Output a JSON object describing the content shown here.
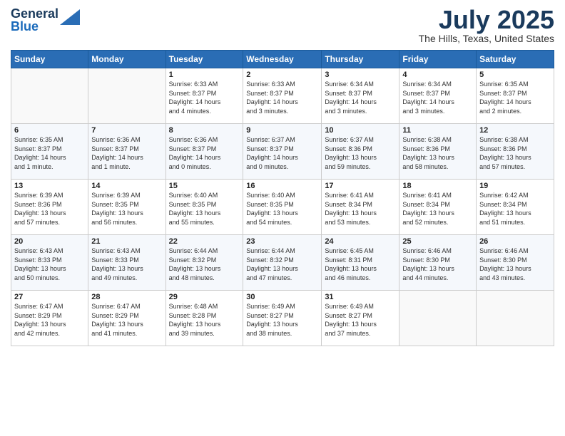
{
  "header": {
    "logo_general": "General",
    "logo_blue": "Blue",
    "month_title": "July 2025",
    "location": "The Hills, Texas, United States"
  },
  "weekdays": [
    "Sunday",
    "Monday",
    "Tuesday",
    "Wednesday",
    "Thursday",
    "Friday",
    "Saturday"
  ],
  "weeks": [
    [
      {
        "day": "",
        "info": ""
      },
      {
        "day": "",
        "info": ""
      },
      {
        "day": "1",
        "info": "Sunrise: 6:33 AM\nSunset: 8:37 PM\nDaylight: 14 hours\nand 4 minutes."
      },
      {
        "day": "2",
        "info": "Sunrise: 6:33 AM\nSunset: 8:37 PM\nDaylight: 14 hours\nand 3 minutes."
      },
      {
        "day": "3",
        "info": "Sunrise: 6:34 AM\nSunset: 8:37 PM\nDaylight: 14 hours\nand 3 minutes."
      },
      {
        "day": "4",
        "info": "Sunrise: 6:34 AM\nSunset: 8:37 PM\nDaylight: 14 hours\nand 3 minutes."
      },
      {
        "day": "5",
        "info": "Sunrise: 6:35 AM\nSunset: 8:37 PM\nDaylight: 14 hours\nand 2 minutes."
      }
    ],
    [
      {
        "day": "6",
        "info": "Sunrise: 6:35 AM\nSunset: 8:37 PM\nDaylight: 14 hours\nand 1 minute."
      },
      {
        "day": "7",
        "info": "Sunrise: 6:36 AM\nSunset: 8:37 PM\nDaylight: 14 hours\nand 1 minute."
      },
      {
        "day": "8",
        "info": "Sunrise: 6:36 AM\nSunset: 8:37 PM\nDaylight: 14 hours\nand 0 minutes."
      },
      {
        "day": "9",
        "info": "Sunrise: 6:37 AM\nSunset: 8:37 PM\nDaylight: 14 hours\nand 0 minutes."
      },
      {
        "day": "10",
        "info": "Sunrise: 6:37 AM\nSunset: 8:36 PM\nDaylight: 13 hours\nand 59 minutes."
      },
      {
        "day": "11",
        "info": "Sunrise: 6:38 AM\nSunset: 8:36 PM\nDaylight: 13 hours\nand 58 minutes."
      },
      {
        "day": "12",
        "info": "Sunrise: 6:38 AM\nSunset: 8:36 PM\nDaylight: 13 hours\nand 57 minutes."
      }
    ],
    [
      {
        "day": "13",
        "info": "Sunrise: 6:39 AM\nSunset: 8:36 PM\nDaylight: 13 hours\nand 57 minutes."
      },
      {
        "day": "14",
        "info": "Sunrise: 6:39 AM\nSunset: 8:35 PM\nDaylight: 13 hours\nand 56 minutes."
      },
      {
        "day": "15",
        "info": "Sunrise: 6:40 AM\nSunset: 8:35 PM\nDaylight: 13 hours\nand 55 minutes."
      },
      {
        "day": "16",
        "info": "Sunrise: 6:40 AM\nSunset: 8:35 PM\nDaylight: 13 hours\nand 54 minutes."
      },
      {
        "day": "17",
        "info": "Sunrise: 6:41 AM\nSunset: 8:34 PM\nDaylight: 13 hours\nand 53 minutes."
      },
      {
        "day": "18",
        "info": "Sunrise: 6:41 AM\nSunset: 8:34 PM\nDaylight: 13 hours\nand 52 minutes."
      },
      {
        "day": "19",
        "info": "Sunrise: 6:42 AM\nSunset: 8:34 PM\nDaylight: 13 hours\nand 51 minutes."
      }
    ],
    [
      {
        "day": "20",
        "info": "Sunrise: 6:43 AM\nSunset: 8:33 PM\nDaylight: 13 hours\nand 50 minutes."
      },
      {
        "day": "21",
        "info": "Sunrise: 6:43 AM\nSunset: 8:33 PM\nDaylight: 13 hours\nand 49 minutes."
      },
      {
        "day": "22",
        "info": "Sunrise: 6:44 AM\nSunset: 8:32 PM\nDaylight: 13 hours\nand 48 minutes."
      },
      {
        "day": "23",
        "info": "Sunrise: 6:44 AM\nSunset: 8:32 PM\nDaylight: 13 hours\nand 47 minutes."
      },
      {
        "day": "24",
        "info": "Sunrise: 6:45 AM\nSunset: 8:31 PM\nDaylight: 13 hours\nand 46 minutes."
      },
      {
        "day": "25",
        "info": "Sunrise: 6:46 AM\nSunset: 8:30 PM\nDaylight: 13 hours\nand 44 minutes."
      },
      {
        "day": "26",
        "info": "Sunrise: 6:46 AM\nSunset: 8:30 PM\nDaylight: 13 hours\nand 43 minutes."
      }
    ],
    [
      {
        "day": "27",
        "info": "Sunrise: 6:47 AM\nSunset: 8:29 PM\nDaylight: 13 hours\nand 42 minutes."
      },
      {
        "day": "28",
        "info": "Sunrise: 6:47 AM\nSunset: 8:29 PM\nDaylight: 13 hours\nand 41 minutes."
      },
      {
        "day": "29",
        "info": "Sunrise: 6:48 AM\nSunset: 8:28 PM\nDaylight: 13 hours\nand 39 minutes."
      },
      {
        "day": "30",
        "info": "Sunrise: 6:49 AM\nSunset: 8:27 PM\nDaylight: 13 hours\nand 38 minutes."
      },
      {
        "day": "31",
        "info": "Sunrise: 6:49 AM\nSunset: 8:27 PM\nDaylight: 13 hours\nand 37 minutes."
      },
      {
        "day": "",
        "info": ""
      },
      {
        "day": "",
        "info": ""
      }
    ]
  ]
}
